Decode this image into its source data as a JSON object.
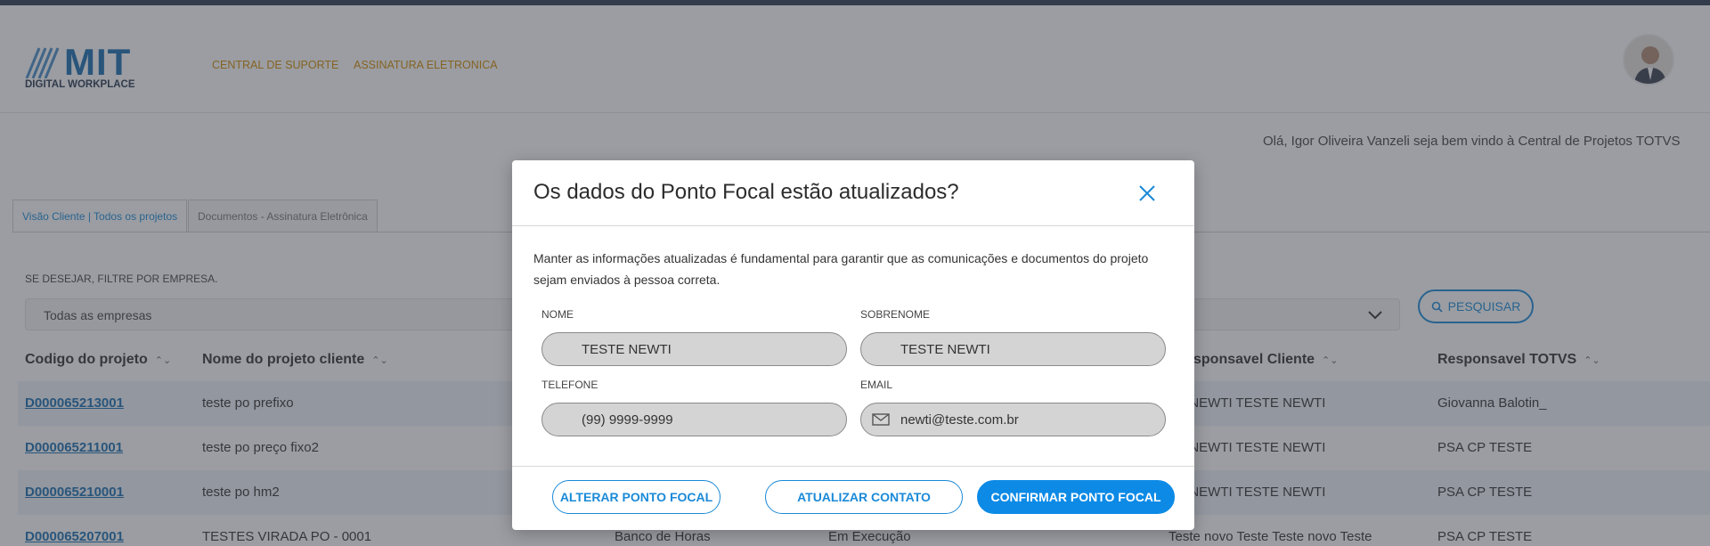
{
  "header": {
    "logo_text": "MIT",
    "logo_sub": "DIGITAL WORKPLACE",
    "nav": [
      "CENTRAL DE SUPORTE",
      "ASSINATURA ELETRONICA"
    ]
  },
  "welcome": "Olá, Igor Oliveira Vanzeli seja bem vindo à Central de Projetos TOTVS",
  "tabs": [
    "Visão Cliente | Todos os projetos",
    "Documentos - Assinatura Eletrônica"
  ],
  "filter": {
    "label": "SE DESEJAR, FILTRE POR EMPRESA.",
    "company_value": "Todas as empresas",
    "search_label": "PESQUISAR"
  },
  "table": {
    "headers": [
      "Codigo do projeto",
      "Nome do projeto cliente",
      "sponsavel Cliente",
      "Responsavel TOTVS"
    ],
    "rows": [
      {
        "code": "D000065213001",
        "name": "teste po prefixo",
        "c3": "",
        "c4": "",
        "client": "TE NEWTI TESTE NEWTI",
        "totvs": "Giovanna Balotin_"
      },
      {
        "code": "D000065211001",
        "name": "teste po preço fixo2",
        "c3": "",
        "c4": "",
        "client": "TE NEWTI TESTE NEWTI",
        "totvs": "PSA CP TESTE"
      },
      {
        "code": "D000065210001",
        "name": "teste po hm2",
        "c3": "",
        "c4": "",
        "client": "TE NEWTI TESTE NEWTI",
        "totvs": "PSA CP TESTE"
      },
      {
        "code": "D000065207001",
        "name": "TESTES VIRADA PO - 0001",
        "c3": "Banco de Horas",
        "c4": "Em Execução",
        "client": "Teste novo Teste Teste novo Teste",
        "totvs": "PSA CP TESTE"
      }
    ]
  },
  "modal": {
    "title": "Os dados do Ponto Focal estão atualizados?",
    "description": "Manter as informações atualizadas é fundamental para garantir que as comunicações e documentos do projeto sejam enviados à pessoa correta.",
    "fields": {
      "nome_label": "NOME",
      "nome_value": "TESTE NEWTI",
      "sobrenome_label": "SOBRENOME",
      "sobrenome_value": "TESTE NEWTI",
      "telefone_label": "TELEFONE",
      "telefone_value": "(99) 9999-9999",
      "email_label": "EMAIL",
      "email_value": "newti@teste.com.br"
    },
    "buttons": {
      "alterar": "ALTERAR PONTO FOCAL",
      "atualizar": "ATUALIZAR CONTATO",
      "confirmar": "CONFIRMAR PONTO FOCAL"
    }
  },
  "colors": {
    "accent": "#1a8ad8",
    "primary_button": "#0c8ae6",
    "nav_link": "#d18b00",
    "logo": "#1a6fb0"
  }
}
